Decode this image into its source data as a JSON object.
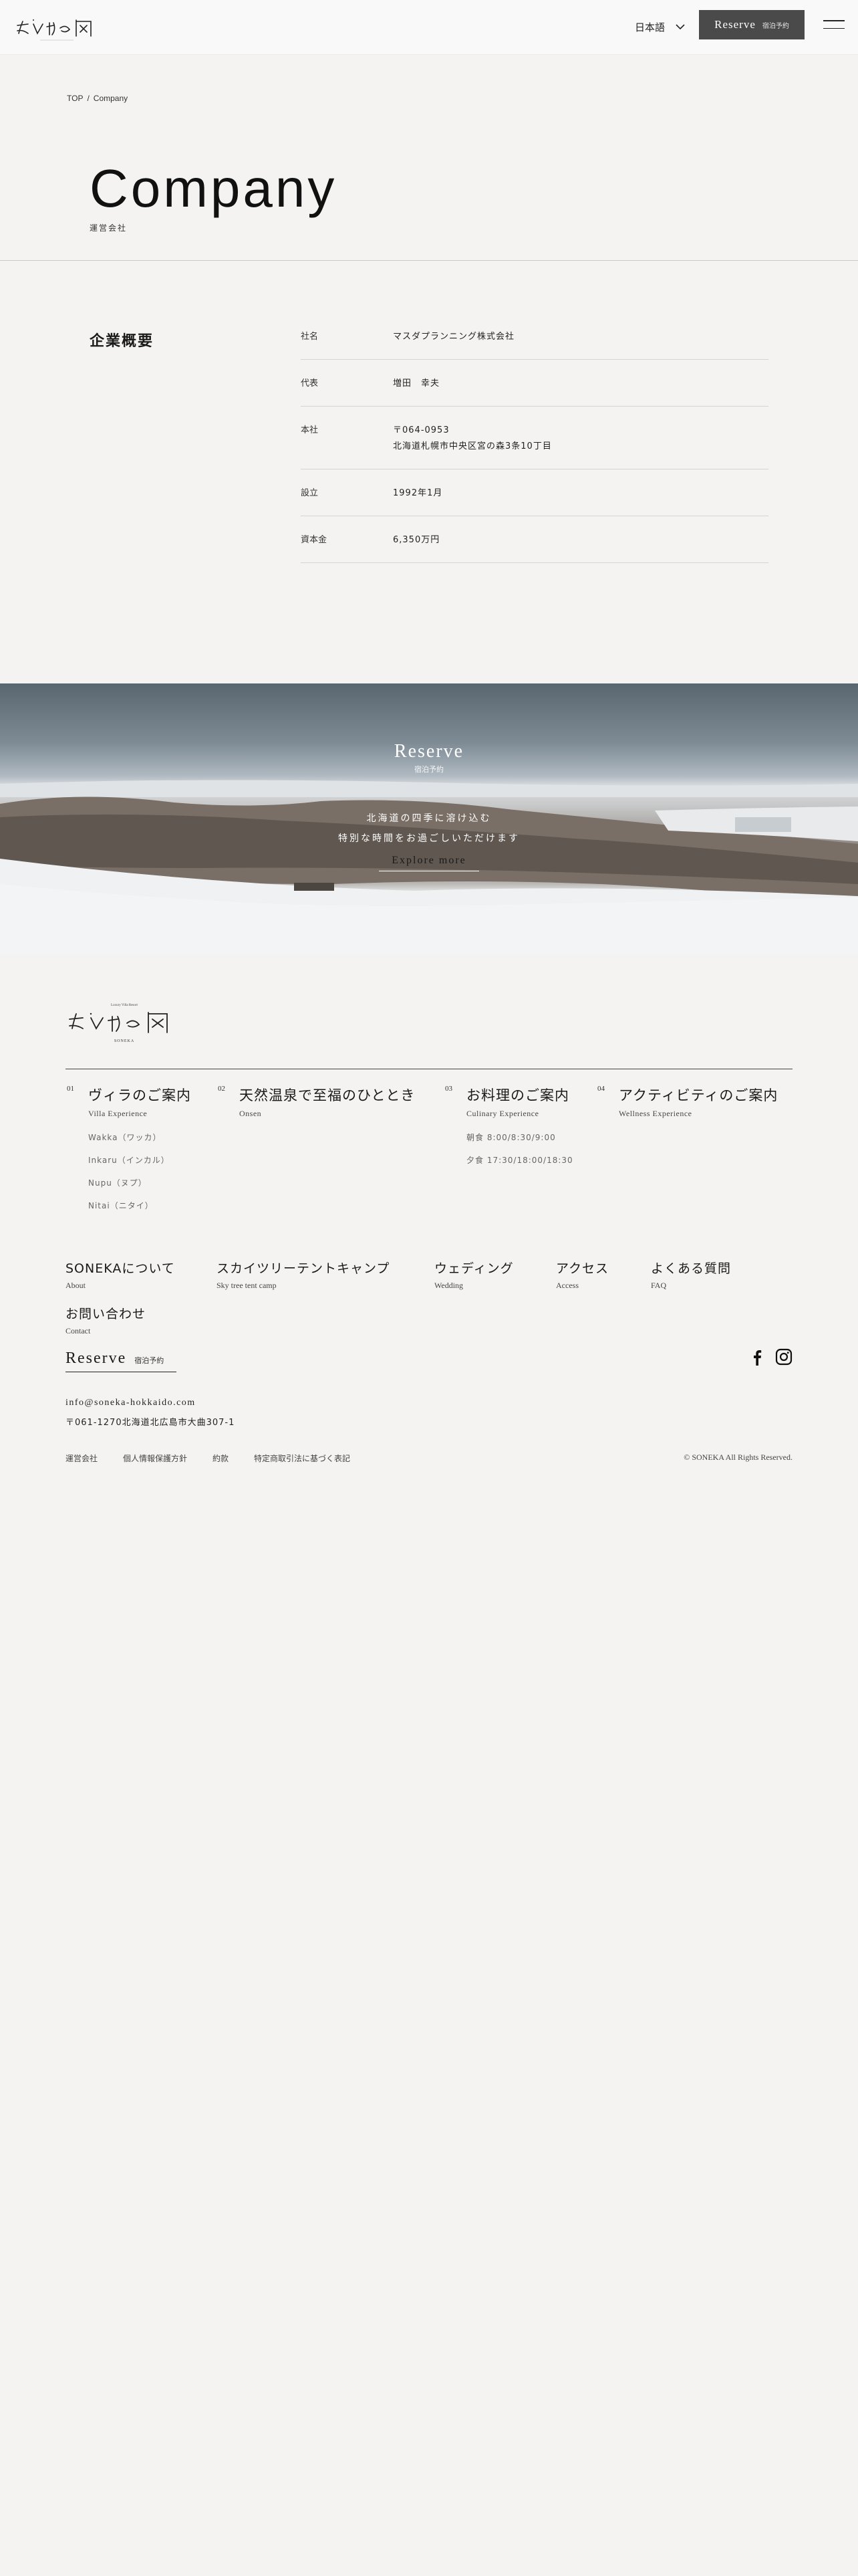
{
  "header": {
    "logo_alt": "SONEKA",
    "language": "日本語",
    "reserve_label": "Reserve",
    "reserve_sub": "宿泊予約"
  },
  "breadcrumb": {
    "home": "TOP",
    "separator": "/",
    "current": "Company"
  },
  "page": {
    "title": "Company",
    "subtitle": "運営会社"
  },
  "company": {
    "heading": "企業概要",
    "rows": [
      {
        "label": "社名",
        "value": "マスダプランニング株式会社"
      },
      {
        "label": "代表",
        "value": "増田　幸夫"
      },
      {
        "label": "本社",
        "value": "〒064-0953",
        "value2": "北海道札幌市中央区宮の森3条10丁目"
      },
      {
        "label": "設立",
        "value": "1992年1月"
      },
      {
        "label": "資本金",
        "value": "6,350万円"
      }
    ]
  },
  "hero": {
    "title": "Reserve",
    "subtitle": "宿泊予約",
    "copy_line1": "北海道の四季に溶け込む",
    "copy_line2": "特別な時間をお過ごしいただけます",
    "link": "Explore more"
  },
  "footer": {
    "logo_tagline": "Luxury Villa Resort",
    "logo_name": "SONEKA",
    "columns": [
      {
        "num": "01",
        "title": "ヴィラのご案内",
        "en": "Villa Experience",
        "subs": [
          "Wakka（ワッカ）",
          "Inkaru（インカル）",
          "Nupu（ヌプ）",
          "Nitai（ニタイ）"
        ]
      },
      {
        "num": "02",
        "title": "天然温泉で至福のひととき",
        "en": "Onsen",
        "subs": []
      },
      {
        "num": "03",
        "title": "お料理のご案内",
        "en": "Culinary Experience",
        "subs": [
          "朝食 8:00/8:30/9:00",
          "夕食 17:30/18:00/18:30"
        ]
      },
      {
        "num": "04",
        "title": "アクティビティのご案内",
        "en": "Wellness Experience",
        "subs": []
      }
    ],
    "nav": [
      {
        "title": "SONEKAについて",
        "en": "About"
      },
      {
        "title": "スカイツリーテントキャンプ",
        "en": "Sky tree tent camp"
      },
      {
        "title": "ウェディング",
        "en": "Wedding"
      },
      {
        "title": "アクセス",
        "en": "Access"
      },
      {
        "title": "よくある質問",
        "en": "FAQ"
      },
      {
        "title": "お問い合わせ",
        "en": "Contact"
      }
    ],
    "reserve_label": "Reserve",
    "reserve_sub": "宿泊予約",
    "email": "info@soneka-hokkaido.com",
    "address": "〒061-1270北海道北広島市大曲307-1",
    "legal": [
      "運営会社",
      "個人情報保護方針",
      "約款",
      "特定商取引法に基づく表記"
    ],
    "copyright": "© SONEKA All Rights Reserved."
  }
}
